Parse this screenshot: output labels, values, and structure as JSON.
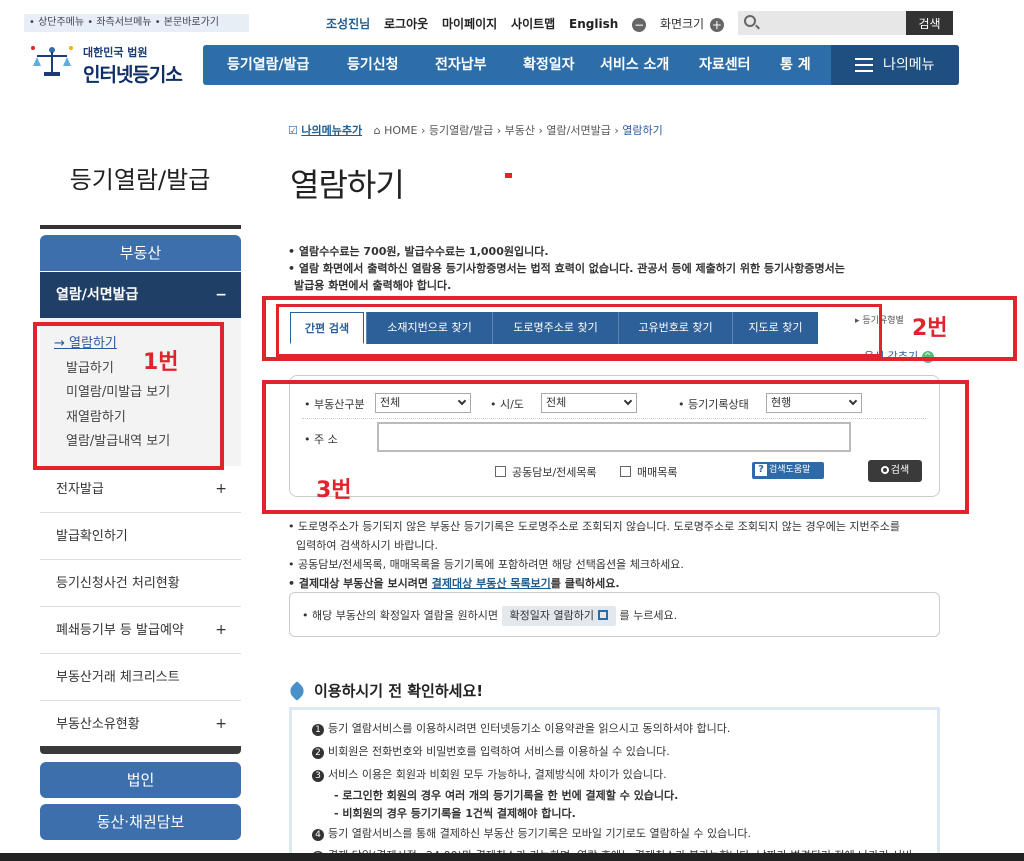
{
  "skip_links": "• 상단주메뉴 • 좌측서브메뉴 • 본문바로가기",
  "logo": {
    "sub": "대한민국 법원",
    "main": "인터넷등기소"
  },
  "util": {
    "user": "조성진님",
    "logout": "로그아웃",
    "mypage": "마이페이지",
    "sitemap": "사이트맵",
    "english": "English",
    "zoom_label": "화면크기",
    "zoom_minus": "−",
    "zoom_plus": "+"
  },
  "search": {
    "placeholder": "",
    "button": "검색"
  },
  "gnb": [
    "등기열람/발급",
    "등기신청",
    "전자납부",
    "확정일자",
    "서비스 소개",
    "자료센터",
    "통 계"
  ],
  "my_menu": "나의메뉴",
  "lnb": {
    "title": "등기열람/발급",
    "section": "부동산",
    "sub_head": "열람/서면발급",
    "sub_toggle": "−",
    "sub_items": [
      "→ 열람하기",
      "발급하기",
      "미열람/미발급 보기",
      "재열람하기",
      "열람/발급내역 보기"
    ],
    "items": [
      {
        "label": "전자발급",
        "toggle": "+"
      },
      {
        "label": "발급확인하기",
        "toggle": ""
      },
      {
        "label": "등기신청사건 처리현황",
        "toggle": ""
      },
      {
        "label": "폐쇄등기부 등 발급예약",
        "toggle": "+"
      },
      {
        "label": "부동산거래 체크리스트",
        "toggle": ""
      },
      {
        "label": "부동산소유현황",
        "toggle": "+"
      }
    ],
    "btn_corp": "법인",
    "btn_movable": "동산·채권담보"
  },
  "annotations": {
    "a1": "1번",
    "a2": "2번",
    "a3": "3번"
  },
  "breadcrumb": {
    "add": "나의메뉴추가",
    "home": "HOME",
    "path": "› 등기열람/발급 › 부동산 › 열람/서면발급 ›",
    "current": "열람하기"
  },
  "page_title": "열람하기",
  "notes": [
    "• 열람수수료는 700원, 발급수수료는 1,000원입니다.",
    "• 열람 화면에서 출력하신 열람용 등기사항증명서는 법적 효력이 없습니다. 관공서 등에 제출하기 위한 등기사항증명서는",
    "발급용 화면에서 출력해야 합니다."
  ],
  "tabs": [
    "간편 검색",
    "소재지번으로 찾기",
    "도로명주소로 찾기",
    "고유번호로 찾기",
    "지도로 찾기"
  ],
  "help_mini": "▸ 등기유형별",
  "hide_label": "옵션 감추기",
  "form": {
    "type_label": "• 부동산구분",
    "type_value": "전체",
    "sido_label": "• 시/도",
    "sido_value": "전체",
    "status_label": "• 등기기록상태",
    "status_value": "현행",
    "addr_label": "• 주 소",
    "addr_value": "",
    "chk1": "공동담보/전세목록",
    "chk2": "매매목록",
    "help_btn": "검색도움말",
    "search_btn": "검색"
  },
  "info_lines": [
    "• 도로명주소가 등기되지 않은 부동산 등기기록은 도로명주소로 조회되지 않습니다. 도로명주소로 조회되지 않는 경우에는 지번주소를",
    "입력하여 검색하시기 바랍니다.",
    "• 공동담보/전세목록, 매매목록을 등기기록에 포함하려면 해당 선택옵션을 체크하세요."
  ],
  "info_line4_prefix": "• 결제대상 부동산을 보시려면 ",
  "info_line4_link": "결제대상 부동산 목록보기",
  "info_line4_suffix": "를 클릭하세요.",
  "infobox": {
    "prefix": "• 해당 부동산의 확정일자 열람을 원하시면",
    "btn": "확정일자 열람하기",
    "suffix": "를 누르세요."
  },
  "check_title": "이용하시기 전 확인하세요!",
  "check_items": [
    {
      "n": "1",
      "text": "등기 열람서비스를 이용하시려면 인터넷등기소 이용약관을 읽으시고 동의하셔야 합니다."
    },
    {
      "n": "2",
      "text": "비회원은 전화번호와 비밀번호를 입력하여 서비스를 이용하실 수 있습니다."
    },
    {
      "n": "3",
      "text": "서비스 이용은 회원과 비회원 모두 가능하나, 결제방식에 차이가 있습니다."
    },
    {
      "n": "",
      "text": "- 로그인한 회원의 경우 여러 개의 등기기록을 한 번에 결제할 수 있습니다."
    },
    {
      "n": "",
      "text": "- 비회원의 경우 등기기록을 1건씩 결제해야 합니다."
    },
    {
      "n": "4",
      "text": "등기 열람서비스를 통해 결제하신 부동산 등기기록은 모바일 기기로도 열람하실 수 있습니다."
    },
    {
      "n": "5",
      "text": "결제 당일(결제시점~24:00)만 결제취소가 가능하며, 열람 후에는 결제취소가 불가능합니다. 날짜가 변경되기 전에 나가기 서비"
    }
  ],
  "colors": {
    "nav_blue": "#2e6ea8",
    "dark_navy": "#1f3f66",
    "annotation_red": "#e1232c"
  }
}
